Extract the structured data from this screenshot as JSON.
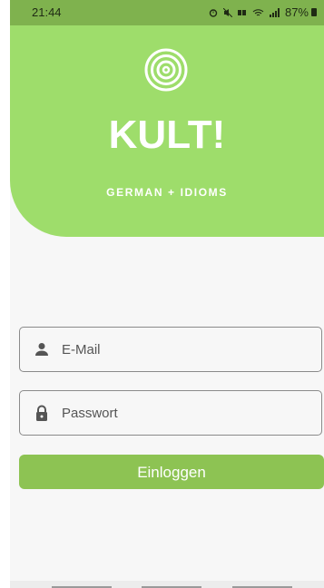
{
  "status_bar": {
    "time": "21:44",
    "icons": [
      "alarm-icon",
      "mute-icon",
      "data-icon",
      "wifi-icon",
      "signal-icon"
    ],
    "battery": "87%"
  },
  "header": {
    "logo_icon": "target-rings-icon",
    "title": "KULT!",
    "subtitle": "GERMAN + IDIOMS"
  },
  "form": {
    "email_placeholder": "E-Mail",
    "email_icon": "person-icon",
    "password_placeholder": "Passwort",
    "password_icon": "lock-icon",
    "login_label": "Einloggen"
  },
  "colors": {
    "header_bg": "#9edd6b",
    "button_bg": "#8dc353",
    "status_bg": "#7fb24e"
  }
}
